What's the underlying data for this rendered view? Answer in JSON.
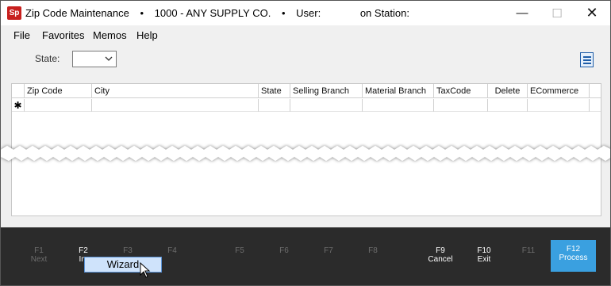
{
  "titlebar": {
    "app_logo": "Sp",
    "title": "Zip Code Maintenance",
    "separator": "•",
    "company": "1000 - ANY SUPPLY CO.",
    "user_label": "User:",
    "station_label": "on Station:",
    "minimize": "—",
    "maximize": "☐",
    "close": "✕"
  },
  "menu": [
    "File",
    "Favorites",
    "Memos",
    "Help"
  ],
  "form": {
    "state_label": "State:",
    "state_value": ""
  },
  "grid": {
    "columns": [
      "Zip Code",
      "City",
      "State",
      "Selling Branch",
      "Material Branch",
      "TaxCode",
      "Delete",
      "ECommerce"
    ],
    "new_row_indicator": "✱"
  },
  "function_keys": [
    {
      "key": "F1",
      "label": "Next",
      "enabled": false
    },
    {
      "key": "F2",
      "label": "Im",
      "enabled": true
    },
    {
      "key": "F3",
      "label": "",
      "enabled": false
    },
    {
      "key": "F4",
      "label": "",
      "enabled": false
    },
    {
      "key": "F5",
      "label": "",
      "enabled": false
    },
    {
      "key": "F6",
      "label": "",
      "enabled": false
    },
    {
      "key": "F7",
      "label": "",
      "enabled": false
    },
    {
      "key": "F8",
      "label": "",
      "enabled": false
    },
    {
      "key": "F9",
      "label": "Cancel",
      "enabled": true
    },
    {
      "key": "F10",
      "label": "Exit",
      "enabled": true
    },
    {
      "key": "F11",
      "label": "",
      "enabled": false
    },
    {
      "key": "F12",
      "label": "Process",
      "enabled": true
    }
  ],
  "popup": {
    "wizard_label": "Wizard"
  },
  "colors": {
    "accent": "#3aa0e0",
    "logo": "#c8201e",
    "footer": "#2b2b2b"
  }
}
